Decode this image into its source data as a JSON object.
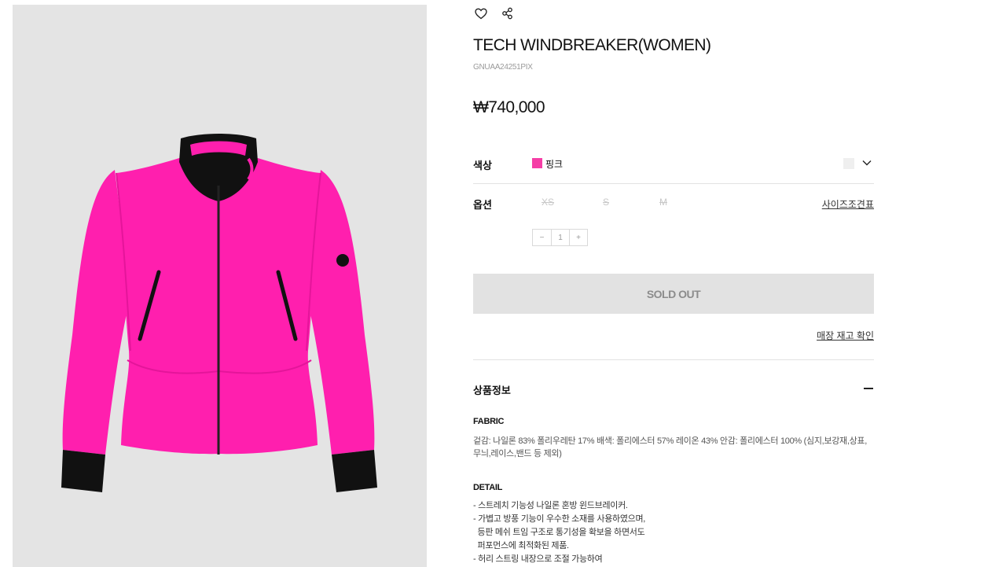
{
  "product": {
    "title": "TECH WINDBREAKER(WOMEN)",
    "code": "GNUAA24251PIX",
    "price": "₩740,000"
  },
  "icons": {
    "wishlist": "heart-icon",
    "share": "share-icon",
    "dropdown": "chevron-down-icon",
    "collapse": "minus-icon"
  },
  "color": {
    "label": "색상",
    "selected_name": "핑크",
    "selected_hex": "#f53ea6"
  },
  "option": {
    "label": "옵션",
    "sizes": [
      "XS",
      "S",
      "M"
    ],
    "size_chart_link": "사이즈조견표"
  },
  "quantity": {
    "minus": "−",
    "value": "1",
    "plus": "+"
  },
  "buttons": {
    "sold_out": "SOLD OUT",
    "store_stock": "매장 재고 확인"
  },
  "product_info": {
    "title": "상품정보",
    "fabric_heading": "FABRIC",
    "fabric_text": "겉감: 나일론 83% 폴리우레탄 17% 배색: 폴리에스터 57% 레이온 43% 안감: 폴리에스터 100% (심지,보강재,상표,무늬,레이스,밴드 등 제외)",
    "detail_heading": "DETAIL",
    "detail_lines": [
      "- 스트레치 기능성 나일론 혼방 윈드브레이커.",
      "- 가볍고 방풍 기능이 우수한 소재를 사용하였으며,",
      "  등판 메쉬 트임 구조로 통기성을 확보을 하면서도",
      "  퍼포먼스에 최적화된 제품.",
      "- 허리 스트링 내장으로 조절 가능하여"
    ]
  },
  "colors": {
    "jacket_pink": "#ff1fae",
    "background_gray": "#e4e4e4",
    "sold_out_bg": "#e2e2e2"
  }
}
